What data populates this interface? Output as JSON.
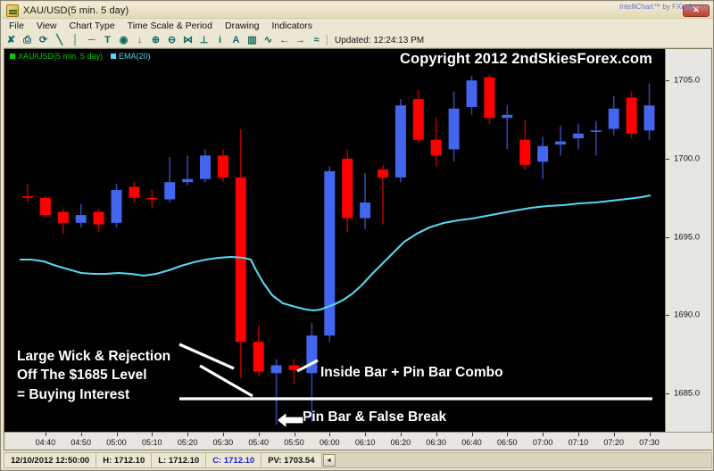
{
  "window": {
    "title": "XAU/USD(5 min.  5 day)",
    "icon": "chart-window-icon",
    "close_label": "✕"
  },
  "menu": {
    "items": [
      {
        "label": "File"
      },
      {
        "label": "View"
      },
      {
        "label": "Chart Type"
      },
      {
        "label": "Time Scale & Period"
      },
      {
        "label": "Drawing"
      },
      {
        "label": "Indicators"
      }
    ]
  },
  "toolbar": {
    "tools": [
      {
        "name": "crosshair-cursor-icon",
        "glyph": "✘"
      },
      {
        "name": "print-icon",
        "glyph": "⎙"
      },
      {
        "name": "refresh-icon",
        "glyph": "⟳"
      },
      {
        "name": "trendline-icon",
        "glyph": "╲"
      },
      {
        "name": "vertical-line-icon",
        "glyph": "│"
      },
      {
        "name": "horizontal-line-icon",
        "glyph": "─"
      },
      {
        "name": "text-tool-icon",
        "glyph": "T"
      },
      {
        "name": "ellipse-icon",
        "glyph": "◉"
      },
      {
        "name": "arrow-down-icon",
        "glyph": "↓"
      },
      {
        "name": "zoom-in-icon",
        "glyph": "⊕"
      },
      {
        "name": "zoom-out-icon",
        "glyph": "⊖"
      },
      {
        "name": "fibonacci-icon",
        "glyph": "⋈"
      },
      {
        "name": "anchor-icon",
        "glyph": "⊥"
      },
      {
        "name": "info-icon",
        "glyph": "i"
      },
      {
        "name": "font-icon",
        "glyph": "A"
      },
      {
        "name": "bar-chart-icon",
        "glyph": "▥"
      },
      {
        "name": "line-chart-icon",
        "glyph": "∿"
      },
      {
        "name": "scroll-left-icon",
        "glyph": "←"
      },
      {
        "name": "scroll-right-icon",
        "glyph": "→"
      },
      {
        "name": "compare-icon",
        "glyph": "≈"
      }
    ],
    "updated_label": "Updated: 12:24:13 PM"
  },
  "legend": {
    "entries": [
      {
        "label": "XAU/USD(5 min.  5 day)",
        "color": "#00cc00"
      },
      {
        "label": "EMA(20)",
        "color": "#55d8ef"
      }
    ]
  },
  "watermark": "IntelliChart™ by FXtrek.com",
  "annotations": {
    "copyright": "Copyright 2012 2ndSkiesForex.com",
    "large_wick": [
      "Large Wick & Rejection",
      "Off The $1685 Level",
      "= Buying Interest"
    ],
    "inside_bar": "Inside Bar + Pin Bar Combo",
    "pin_bar": "Pin Bar & False Break",
    "pin_bar_arrow": "arrow-left-icon"
  },
  "statusbar": {
    "datetime": "12/10/2012 12:50:00",
    "high": "H: 1712.10",
    "low": "L: 1712.10",
    "close": "C: 1712.10",
    "pv": "PV: 1703.54",
    "scroll_glyph": "◄"
  },
  "chart_data": {
    "type": "candlestick",
    "title": "XAU/USD(5 min.  5 day)",
    "xlabel": "",
    "ylabel": "",
    "ylim": [
      1682.5,
      1707.0
    ],
    "grid": false,
    "legend_position": "top-left",
    "up_color": "#4466ee",
    "down_color": "#ff0000",
    "up_wick_color": "#3344aa",
    "down_wick_color": "#aa0000",
    "price_ticks": [
      1705.0,
      1700.0,
      1695.0,
      1690.0,
      1685.0
    ],
    "time_ticks": [
      "04:40",
      "04:50",
      "05:00",
      "05:10",
      "05:20",
      "05:30",
      "05:40",
      "05:50",
      "06:00",
      "06:10",
      "06:20",
      "06:30",
      "06:40",
      "06:50",
      "07:00",
      "07:10",
      "07:20",
      "07:30"
    ],
    "overlay_series": [
      {
        "name": "EMA(20)",
        "color": "#55d8ef",
        "type": "line"
      }
    ],
    "candles": [
      {
        "t": "04:36",
        "o": 1697.6,
        "h": 1698.4,
        "l": 1697.2,
        "c": 1697.5,
        "dir": "down"
      },
      {
        "t": "04:41",
        "o": 1697.5,
        "h": 1697.6,
        "l": 1696.2,
        "c": 1696.4,
        "dir": "down"
      },
      {
        "t": "04:46",
        "o": 1696.6,
        "h": 1696.8,
        "l": 1695.2,
        "c": 1695.9,
        "dir": "down"
      },
      {
        "t": "04:51",
        "o": 1695.9,
        "h": 1697.1,
        "l": 1695.6,
        "c": 1696.4,
        "dir": "up"
      },
      {
        "t": "04:56",
        "o": 1696.6,
        "h": 1696.8,
        "l": 1695.3,
        "c": 1695.8,
        "dir": "down"
      },
      {
        "t": "05:01",
        "o": 1695.9,
        "h": 1698.4,
        "l": 1695.6,
        "c": 1698.0,
        "dir": "up"
      },
      {
        "t": "05:06",
        "o": 1698.2,
        "h": 1698.5,
        "l": 1697.2,
        "c": 1697.5,
        "dir": "down"
      },
      {
        "t": "05:11",
        "o": 1697.5,
        "h": 1698.0,
        "l": 1696.8,
        "c": 1697.4,
        "dir": "down"
      },
      {
        "t": "05:16",
        "o": 1697.4,
        "h": 1700.1,
        "l": 1697.2,
        "c": 1698.5,
        "dir": "up"
      },
      {
        "t": "05:21",
        "o": 1698.5,
        "h": 1700.2,
        "l": 1698.3,
        "c": 1698.7,
        "dir": "up"
      },
      {
        "t": "05:26",
        "o": 1698.7,
        "h": 1700.6,
        "l": 1698.5,
        "c": 1700.2,
        "dir": "up"
      },
      {
        "t": "05:31",
        "o": 1700.2,
        "h": 1700.6,
        "l": 1698.5,
        "c": 1698.8,
        "dir": "down"
      },
      {
        "t": "05:36",
        "o": 1698.8,
        "h": 1701.9,
        "l": 1686.0,
        "c": 1688.3,
        "dir": "down"
      },
      {
        "t": "05:41",
        "o": 1688.3,
        "h": 1689.3,
        "l": 1686.1,
        "c": 1686.4,
        "dir": "down"
      },
      {
        "t": "05:46",
        "o": 1686.8,
        "h": 1687.2,
        "l": 1683.0,
        "c": 1686.3,
        "dir": "up"
      },
      {
        "t": "05:51",
        "o": 1686.8,
        "h": 1687.2,
        "l": 1685.6,
        "c": 1686.5,
        "dir": "down"
      },
      {
        "t": "05:56",
        "o": 1686.3,
        "h": 1689.5,
        "l": 1683.2,
        "c": 1688.7,
        "dir": "up"
      },
      {
        "t": "06:01",
        "o": 1688.7,
        "h": 1699.5,
        "l": 1688.3,
        "c": 1699.2,
        "dir": "up"
      },
      {
        "t": "06:06",
        "o": 1700.0,
        "h": 1700.6,
        "l": 1695.3,
        "c": 1696.2,
        "dir": "down"
      },
      {
        "t": "06:11",
        "o": 1696.2,
        "h": 1699.1,
        "l": 1695.5,
        "c": 1697.2,
        "dir": "up"
      },
      {
        "t": "06:16",
        "o": 1699.3,
        "h": 1699.6,
        "l": 1695.8,
        "c": 1698.8,
        "dir": "down"
      },
      {
        "t": "06:21",
        "o": 1698.8,
        "h": 1703.8,
        "l": 1698.5,
        "c": 1703.4,
        "dir": "up"
      },
      {
        "t": "06:26",
        "o": 1703.8,
        "h": 1704.4,
        "l": 1701.0,
        "c": 1701.2,
        "dir": "down"
      },
      {
        "t": "06:31",
        "o": 1701.2,
        "h": 1702.6,
        "l": 1699.5,
        "c": 1700.2,
        "dir": "down"
      },
      {
        "t": "06:36",
        "o": 1700.6,
        "h": 1704.3,
        "l": 1699.8,
        "c": 1703.2,
        "dir": "up"
      },
      {
        "t": "06:41",
        "o": 1703.3,
        "h": 1705.3,
        "l": 1702.8,
        "c": 1705.0,
        "dir": "up"
      },
      {
        "t": "06:46",
        "o": 1705.2,
        "h": 1705.4,
        "l": 1702.2,
        "c": 1702.6,
        "dir": "down"
      },
      {
        "t": "06:51",
        "o": 1702.6,
        "h": 1703.4,
        "l": 1700.6,
        "c": 1702.8,
        "dir": "up"
      },
      {
        "t": "06:56",
        "o": 1701.2,
        "h": 1702.5,
        "l": 1699.3,
        "c": 1699.6,
        "dir": "down"
      },
      {
        "t": "07:01",
        "o": 1699.8,
        "h": 1701.4,
        "l": 1698.7,
        "c": 1700.8,
        "dir": "up"
      },
      {
        "t": "07:06",
        "o": 1700.9,
        "h": 1702.1,
        "l": 1700.2,
        "c": 1701.1,
        "dir": "up"
      },
      {
        "t": "07:11",
        "o": 1701.3,
        "h": 1702.2,
        "l": 1700.6,
        "c": 1701.6,
        "dir": "up"
      },
      {
        "t": "07:16",
        "o": 1701.7,
        "h": 1702.4,
        "l": 1700.2,
        "c": 1701.8,
        "dir": "up"
      },
      {
        "t": "07:21",
        "o": 1701.9,
        "h": 1704.0,
        "l": 1701.5,
        "c": 1703.2,
        "dir": "up"
      },
      {
        "t": "07:26",
        "o": 1703.9,
        "h": 1704.3,
        "l": 1701.3,
        "c": 1701.6,
        "dir": "down"
      },
      {
        "t": "07:31",
        "o": 1703.4,
        "h": 1704.8,
        "l": 1701.2,
        "c": 1701.8,
        "dir": "up"
      }
    ],
    "ema_points": [
      [
        17,
        236
      ],
      [
        30,
        236
      ],
      [
        44,
        238
      ],
      [
        58,
        243
      ],
      [
        72,
        247
      ],
      [
        86,
        251
      ],
      [
        100,
        252
      ],
      [
        114,
        252
      ],
      [
        128,
        251
      ],
      [
        142,
        252
      ],
      [
        156,
        254
      ],
      [
        170,
        252
      ],
      [
        184,
        248
      ],
      [
        198,
        243
      ],
      [
        212,
        239
      ],
      [
        226,
        236
      ],
      [
        240,
        234
      ],
      [
        254,
        233
      ],
      [
        268,
        234
      ],
      [
        276,
        236
      ],
      [
        282,
        248
      ],
      [
        290,
        262
      ],
      [
        300,
        276
      ],
      [
        312,
        285
      ],
      [
        326,
        289
      ],
      [
        338,
        292
      ],
      [
        347,
        293
      ],
      [
        354,
        292
      ],
      [
        362,
        289
      ],
      [
        370,
        286
      ],
      [
        380,
        281
      ],
      [
        390,
        274
      ],
      [
        400,
        265
      ],
      [
        412,
        252
      ],
      [
        424,
        240
      ],
      [
        436,
        228
      ],
      [
        448,
        216
      ],
      [
        462,
        207
      ],
      [
        476,
        200
      ],
      [
        492,
        195
      ],
      [
        508,
        192
      ],
      [
        524,
        190
      ],
      [
        540,
        187
      ],
      [
        556,
        184
      ],
      [
        572,
        181
      ],
      [
        590,
        178
      ],
      [
        608,
        176
      ],
      [
        626,
        175
      ],
      [
        644,
        173
      ],
      [
        662,
        172
      ],
      [
        680,
        170
      ],
      [
        698,
        168
      ],
      [
        714,
        166
      ],
      [
        724,
        164
      ]
    ]
  }
}
